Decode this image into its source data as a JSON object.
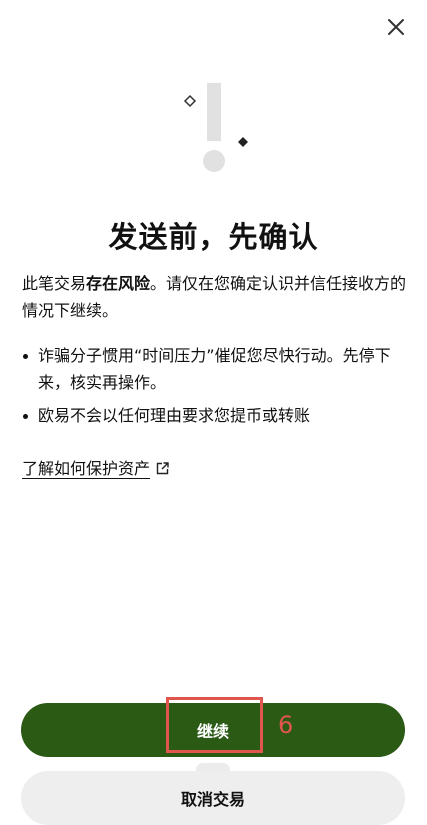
{
  "dialog": {
    "title": "发送前，先确认",
    "intro_prefix": "此笔交易",
    "intro_emphasis": "存在风险",
    "intro_suffix": "。请仅在您确定认识并信任接收方的情况下继续。",
    "bullets": [
      "诈骗分子惯用“时间压力”催促您尽快行动。先停下来，核实再操作。",
      "欧易不会以任何理由要求您提币或转账"
    ],
    "learn_link": "了解如何保护资产"
  },
  "buttons": {
    "continue_label": "继续",
    "cancel_label": "取消交易"
  },
  "annotation": {
    "number": "6"
  },
  "icons": {
    "close": "close-icon",
    "warning": "exclamation-warning-icon",
    "external_link": "external-link-icon"
  },
  "colors": {
    "primary_button": "#2a5a14",
    "secondary_button": "#eeeeee",
    "annotation": "#e0554d"
  }
}
